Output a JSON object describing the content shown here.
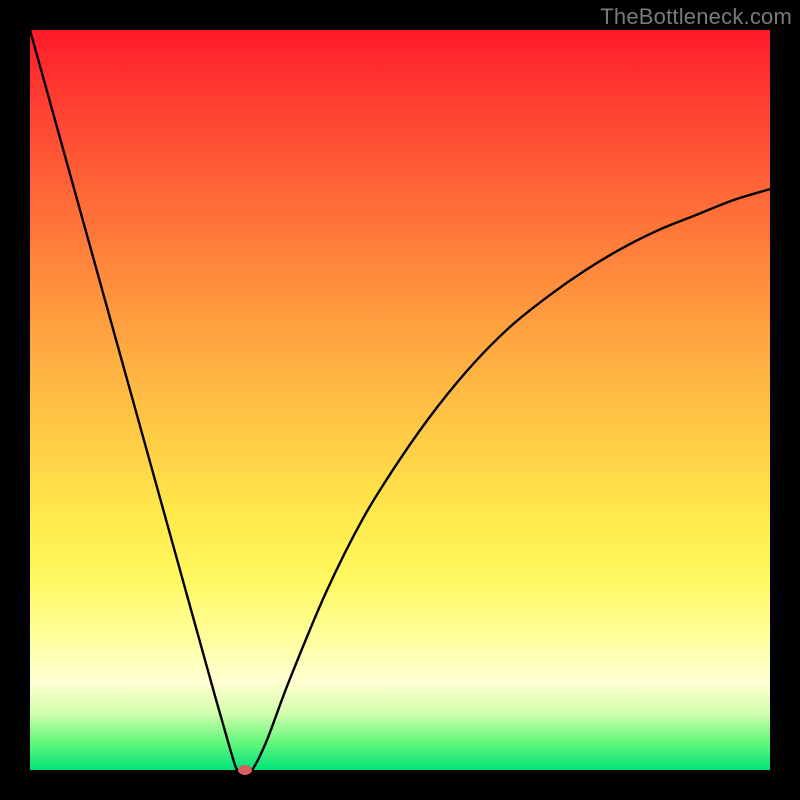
{
  "watermark": "TheBottleneck.com",
  "colors": {
    "curve_stroke": "#000000",
    "marker_fill": "#d7615a",
    "frame_bg": "#000000"
  },
  "chart_data": {
    "type": "line",
    "title": "",
    "xlabel": "",
    "ylabel": "",
    "xlim": [
      0,
      100
    ],
    "ylim": [
      0,
      100
    ],
    "grid": false,
    "series": [
      {
        "name": "bottleneck-curve",
        "x": [
          0,
          5,
          10,
          15,
          20,
          25,
          27,
          28,
          29,
          30,
          32,
          35,
          40,
          45,
          50,
          55,
          60,
          65,
          70,
          75,
          80,
          85,
          90,
          95,
          100
        ],
        "values": [
          100,
          82,
          64,
          46,
          28,
          10,
          3,
          0,
          0,
          0,
          4,
          12,
          24,
          34,
          42,
          49,
          55,
          60,
          64,
          67.5,
          70.5,
          73,
          75,
          77,
          78.5
        ]
      }
    ],
    "annotations": [
      {
        "name": "optimal-marker",
        "x": 29,
        "y": 0
      }
    ],
    "background_gradient": {
      "top": "#ff1a2a",
      "mid": "#ffea4c",
      "bottom": "#00e47a"
    }
  }
}
